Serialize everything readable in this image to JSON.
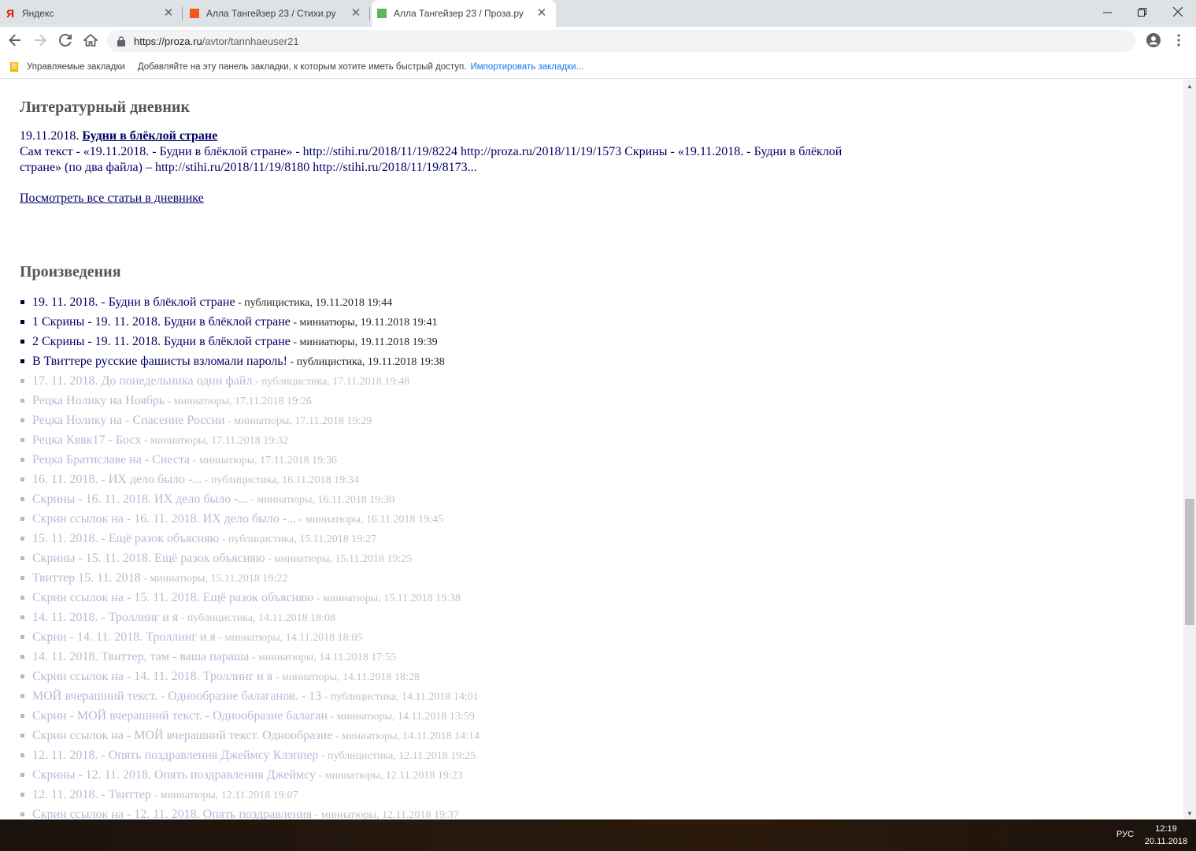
{
  "browser": {
    "tabs": [
      {
        "title": "Яндекс",
        "favicon": "yandex-icon",
        "active": false
      },
      {
        "title": "Алла Тангейзер 23 / Стихи.ру",
        "favicon": "stihi-icon",
        "active": false
      },
      {
        "title": "Алла Тангейзер 23 / Проза.ру",
        "favicon": "proza-icon",
        "active": true
      }
    ],
    "url_host": "https://proza.ru",
    "url_path": "/avtor/tannhaeuser21",
    "bookmarks": {
      "folder_label": "Управляемые закладки",
      "hint": "Добавляйте на эту панель закладки, к которым хотите иметь быстрый доступ.",
      "import_link": "Импортировать закладки..."
    }
  },
  "page": {
    "diary": {
      "heading": "Литературный дневник",
      "entry_date": "19.11.2018.",
      "entry_title": "Будни в блёклой стране",
      "entry_excerpt": "Сам текст - «19.11.2018. - Будни в блёклой стране» - http://stihi.ru/2018/11/19/8224 http://proza.ru/2018/11/19/1573 Скрины - «19.11.2018. - Будни в блёклой стране» (по два файла) – http://stihi.ru/2018/11/19/8180 http://stihi.ru/2018/11/19/8173...",
      "see_all": "Посмотреть все статьи в дневнике"
    },
    "works": {
      "heading": "Произведения",
      "items": [
        {
          "title": "19. 11. 2018. - Будни в блёклой стране",
          "meta": " - публицистика, 19.11.2018 19:44",
          "faded": false
        },
        {
          "title": "1 Скрины - 19. 11. 2018. Будни в блёклой стране",
          "meta": " - миниатюры, 19.11.2018 19:41",
          "faded": false
        },
        {
          "title": "2 Скрины - 19. 11. 2018. Будни в блёклой стране",
          "meta": " - миниатюры, 19.11.2018 19:39",
          "faded": false
        },
        {
          "title": "В Твиттере русские фашисты взломали пароль!",
          "meta": " - публицистика, 19.11.2018 19:38",
          "faded": false
        },
        {
          "title": "17. 11. 2018. До понедельника один файл",
          "meta": " - публицистика, 17.11.2018 19:48",
          "faded": true
        },
        {
          "title": "Рецка Нолику на Ноябрь",
          "meta": " - миниатюры, 17.11.2018 19:26",
          "faded": true
        },
        {
          "title": "Рецка Нолику на - Спасение России",
          "meta": " - миниатюры, 17.11.2018 19:29",
          "faded": true
        },
        {
          "title": "Рецка Кввк17 - Босх",
          "meta": " - миниатюры, 17.11.2018 19:32",
          "faded": true
        },
        {
          "title": "Рецка Братиславе на - Сиеста",
          "meta": " - миниатюры, 17.11.2018 19:36",
          "faded": true
        },
        {
          "title": "16. 11. 2018. - ИХ дело было -...",
          "meta": " - публицистика, 16.11.2018 19:34",
          "faded": true
        },
        {
          "title": "Скрины - 16. 11. 2018. ИХ дело было -...",
          "meta": " - миниатюры, 16.11.2018 19:30",
          "faded": true
        },
        {
          "title": "Скрин ссылок на - 16. 11. 2018. ИХ дело было -...",
          "meta": " - миниатюры, 16.11.2018 19:45",
          "faded": true
        },
        {
          "title": "15. 11. 2018. - Ещё разок объясняю",
          "meta": " - публицистика, 15.11.2018 19:27",
          "faded": true
        },
        {
          "title": "Скрины - 15. 11. 2018. Ещё разок объясняю",
          "meta": " - миниатюры, 15.11.2018 19:25",
          "faded": true
        },
        {
          "title": "Твиттер 15. 11. 2018",
          "meta": " - миниатюры, 15.11.2018 19:22",
          "faded": true
        },
        {
          "title": "Скрин ссылок на - 15. 11. 2018. Ещё разок объясняю",
          "meta": " - миниатюры, 15.11.2018 19:38",
          "faded": true
        },
        {
          "title": "14. 11. 2018. - Троллинг и я",
          "meta": " - публицистика, 14.11.2018 18:08",
          "faded": true
        },
        {
          "title": "Скрин - 14. 11. 2018. Троллинг и я",
          "meta": " - миниатюры, 14.11.2018 18:05",
          "faded": true
        },
        {
          "title": "14. 11. 2018. Твиттер, там - ваша параша",
          "meta": " - миниатюры, 14.11.2018 17:55",
          "faded": true
        },
        {
          "title": "Скрин ссылок на - 14. 11. 2018. Троллинг и я",
          "meta": " - миниатюры, 14.11.2018 18:28",
          "faded": true
        },
        {
          "title": "МОЙ вчерашний текст. - Однообразие балаганов. - 13",
          "meta": " - публицистика, 14.11.2018 14:01",
          "faded": true
        },
        {
          "title": "Скрин - МОЙ вчерашний текст. - Однообразие балаган",
          "meta": " - миниатюры, 14.11.2018 13:59",
          "faded": true
        },
        {
          "title": "Скрин ссылок на - МОЙ вчерашний текст. Однообразие",
          "meta": " - миниатюры, 14.11.2018 14:14",
          "faded": true
        },
        {
          "title": "12. 11. 2018. - Опять поздравления Джеймсу Клэппер",
          "meta": " - публицистика, 12.11.2018 19:25",
          "faded": true
        },
        {
          "title": "Скрины - 12. 11. 2018. Опять поздравления Джеймсу",
          "meta": " - миниатюры, 12.11.2018 19:23",
          "faded": true
        },
        {
          "title": "12. 11. 2018. - Твиттер",
          "meta": " - миниатюры, 12.11.2018 19:07",
          "faded": true
        },
        {
          "title": "Скрин ссылок на - 12. 11. 2018. Опять поздравления",
          "meta": " - миниатюры, 12.11.2018 19:37",
          "faded": true
        }
      ]
    }
  },
  "taskbar": {
    "language": "РУС",
    "time": "12:19",
    "date": "20.11.2018"
  }
}
